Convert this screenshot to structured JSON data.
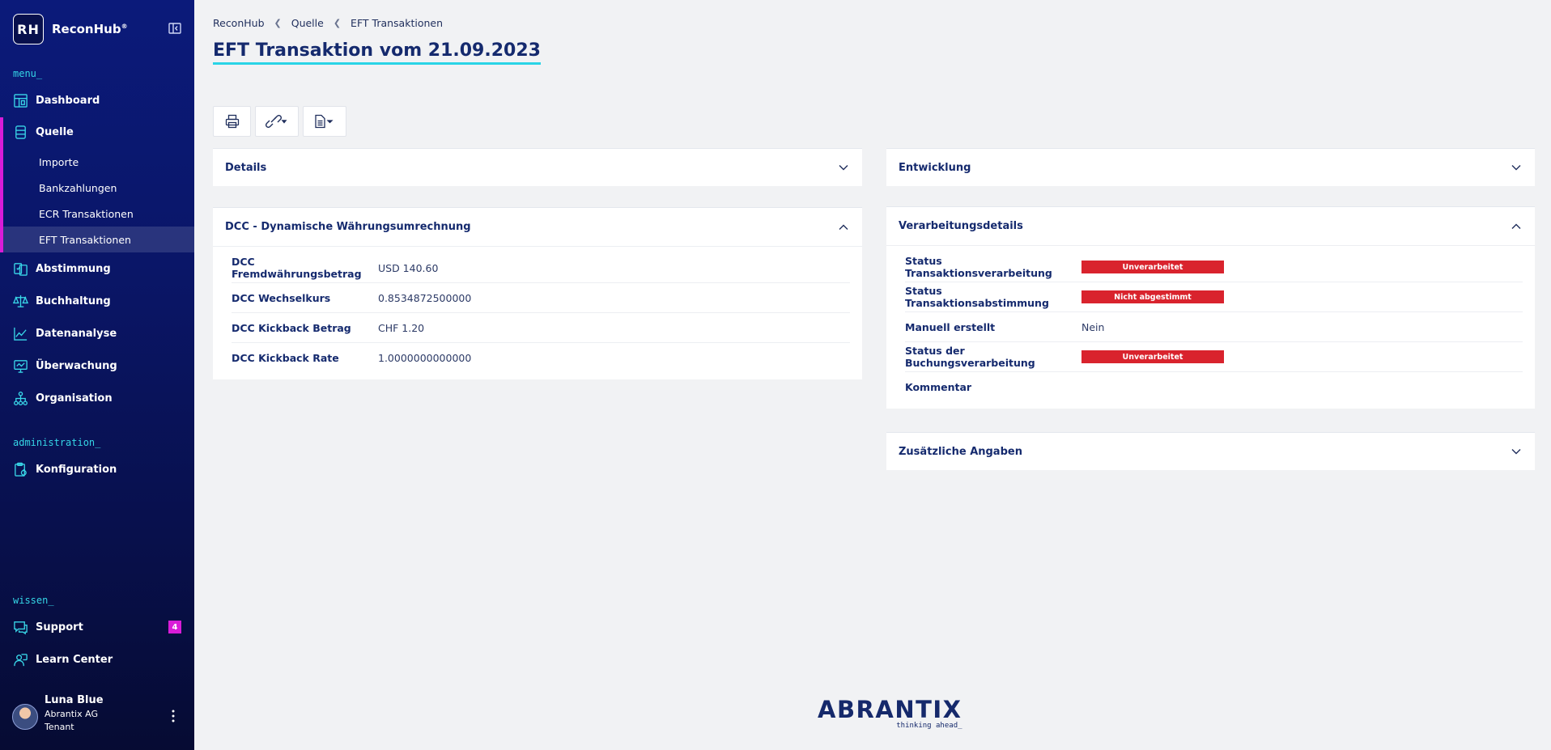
{
  "brand": {
    "logo": "RH",
    "name": "ReconHub",
    "mark": "®"
  },
  "sidebar": {
    "menu_label": "menu_",
    "admin_label": "administration_",
    "wissen_label": "wissen_",
    "items": [
      {
        "label": "Dashboard",
        "icon": "dashboard-icon"
      },
      {
        "label": "Quelle",
        "icon": "database-icon"
      },
      {
        "label": "Abstimmung",
        "icon": "reconcile-icon"
      },
      {
        "label": "Buchhaltung",
        "icon": "scale-icon"
      },
      {
        "label": "Datenanalyse",
        "icon": "chart-icon"
      },
      {
        "label": "Überwachung",
        "icon": "monitor-icon"
      },
      {
        "label": "Organisation",
        "icon": "org-icon"
      }
    ],
    "sub_items": [
      "Importe",
      "Bankzahlungen",
      "ECR Transaktionen",
      "EFT Transaktionen"
    ],
    "admin_items": [
      {
        "label": "Konfiguration",
        "icon": "config-icon"
      }
    ],
    "wissen_items": [
      {
        "label": "Support",
        "icon": "chat-icon",
        "badge": "4"
      },
      {
        "label": "Learn Center",
        "icon": "learn-icon"
      }
    ],
    "accent": "#d91cd8"
  },
  "user": {
    "name": "Luna Blue",
    "company": "Abrantix AG",
    "role": "Tenant"
  },
  "breadcrumb": [
    "ReconHub",
    "Quelle",
    "EFT Transaktionen"
  ],
  "page_title": "EFT Transaktion vom 21.09.2023",
  "panels": {
    "details": {
      "title": "Details"
    },
    "entwicklung": {
      "title": "Entwicklung"
    },
    "dcc": {
      "title": "DCC - Dynamische Währungsumrechnung",
      "rows": [
        {
          "key": "DCC Fremdwährungsbetrag",
          "value": "USD 140.60"
        },
        {
          "key": "DCC Wechselkurs",
          "value": "0.8534872500000"
        },
        {
          "key": "DCC Kickback Betrag",
          "value": "CHF 1.20"
        },
        {
          "key": "DCC Kickback Rate",
          "value": "1.0000000000000"
        }
      ]
    },
    "verarbeitung": {
      "title": "Verarbeitungsdetails",
      "rows": [
        {
          "key": "Status Transaktionsverarbeitung",
          "value": "Unverarbeitet",
          "status": true
        },
        {
          "key": "Status Transaktionsabstimmung",
          "value": "Nicht abgestimmt",
          "status": true
        },
        {
          "key": "Manuell erstellt",
          "value": "Nein",
          "status": false
        },
        {
          "key": "Status der Buchungsverarbeitung",
          "value": "Unverarbeitet",
          "status": true
        },
        {
          "key": "Kommentar",
          "value": "",
          "status": false
        }
      ]
    },
    "zusatz": {
      "title": "Zusätzliche Angaben"
    }
  },
  "footer": {
    "logo": "ABRANTIX",
    "tagline": "thinking ahead_"
  }
}
